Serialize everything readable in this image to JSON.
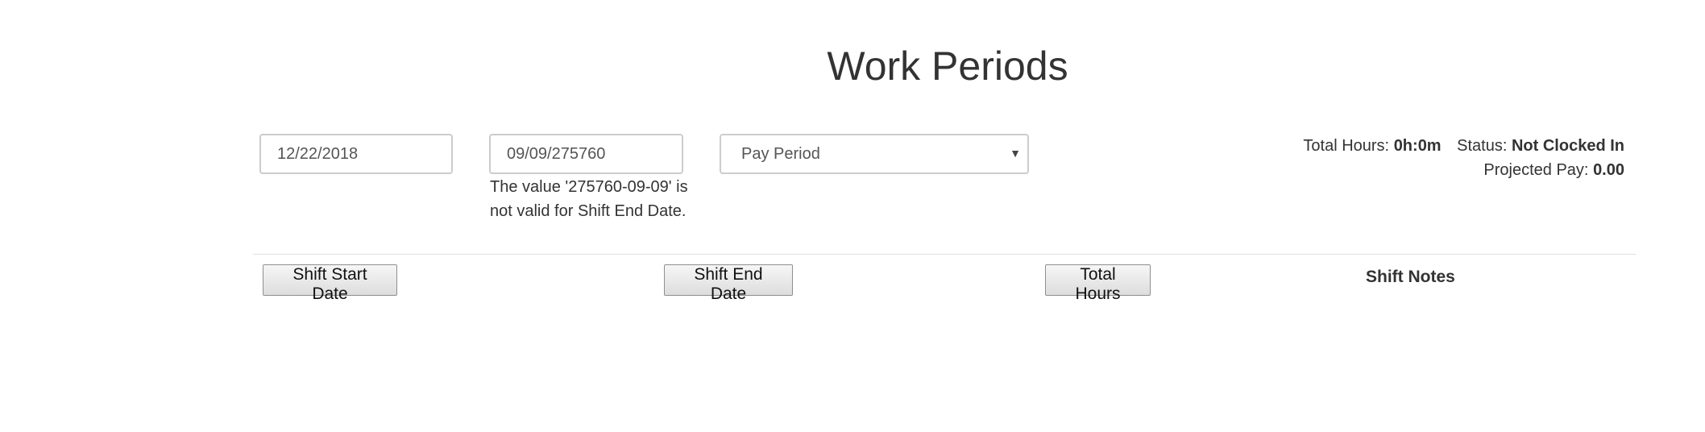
{
  "page": {
    "title": "Work Periods"
  },
  "filters": {
    "start_date": "12/22/2018",
    "end_date": "09/09/275760",
    "period_select": "Pay Period",
    "end_date_error": "The value '275760-09-09' is not valid for Shift End Date."
  },
  "summary": {
    "total_hours_label": "Total Hours:",
    "total_hours_value": "0h:0m",
    "status_label": "Status:",
    "status_value": "Not Clocked In",
    "projected_pay_label": "Projected Pay:",
    "projected_pay_value": "0.00"
  },
  "table": {
    "columns": [
      {
        "label": "Shift Start Date"
      },
      {
        "label": "Shift End Date"
      },
      {
        "label": "Total Hours"
      },
      {
        "label": "Shift Notes"
      }
    ]
  },
  "icons": {
    "select_caret": "chevron-down-icon"
  }
}
